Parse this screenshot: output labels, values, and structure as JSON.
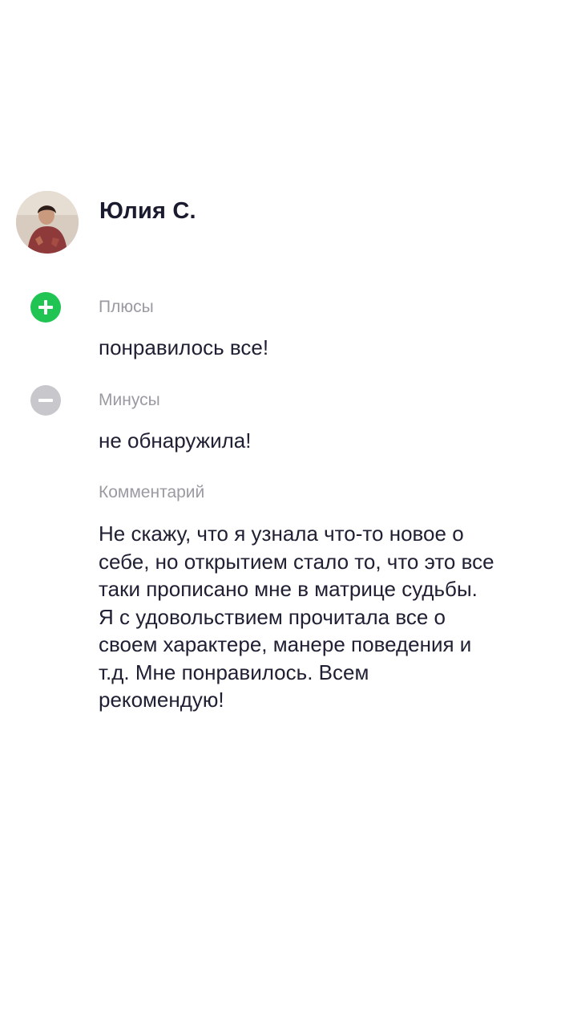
{
  "review": {
    "author": {
      "name": "Юлия С.",
      "avatar_icon": "user-photo"
    },
    "pros": {
      "icon": "plus-circle-icon",
      "icon_color": "#1fc452",
      "label": "Плюсы",
      "text": "понравилось все!"
    },
    "cons": {
      "icon": "minus-circle-icon",
      "icon_color": "#c7c7cc",
      "label": "Минусы",
      "text": "не обнаружила!"
    },
    "comment": {
      "label": "Комментарий",
      "text": "Не скажу, что я узнала что-то новое о\nсебе, но открытием стало то, что это все\nтаки прописано мне в матрице судьбы.\nЯ с удовольствием прочитала все о\nсвоем характере, манере поведения и\nт.д. Мне понравилось. Всем\nрекомендую!"
    }
  }
}
